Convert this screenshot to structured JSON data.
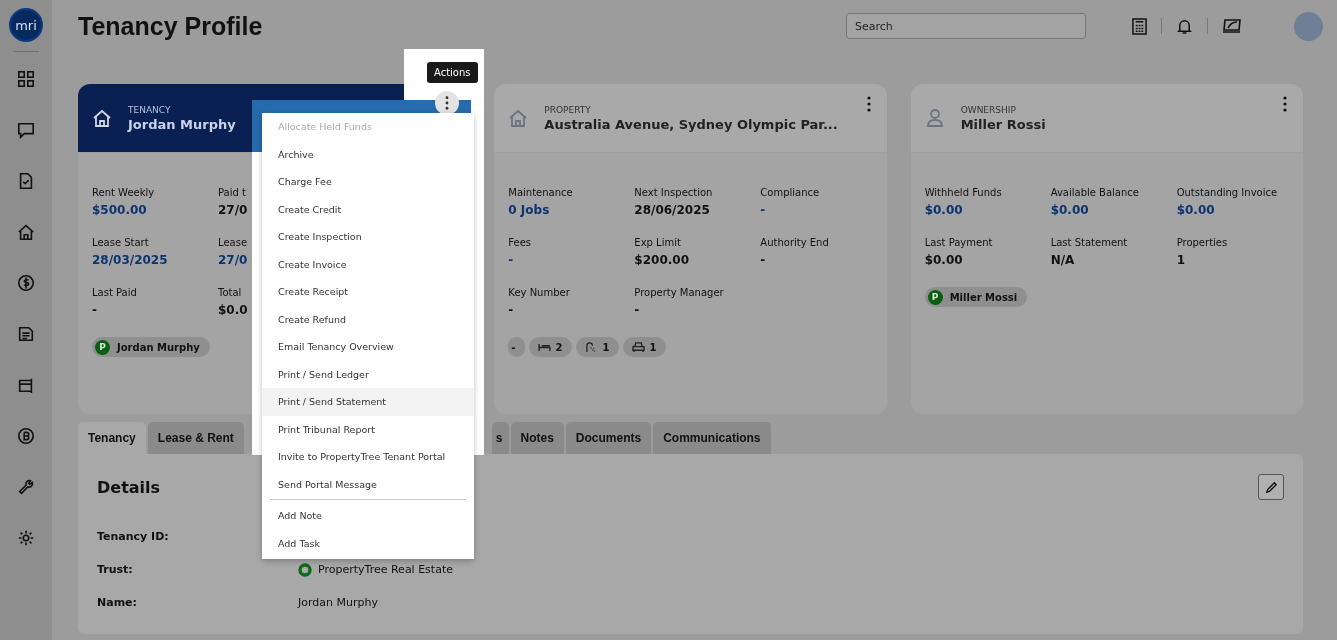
{
  "sidebar": {
    "logo": "mri"
  },
  "page": {
    "title": "Tenancy Profile"
  },
  "header": {
    "search": {
      "placeholder": "Search"
    }
  },
  "cards": [
    {
      "kind": "tenancy",
      "label": "TENANCY",
      "name": "Jordan Murphy",
      "rows": [
        [
          {
            "label": "Rent Weekly",
            "value": "$500.00",
            "link": true
          },
          {
            "label": "Paid t",
            "value": "27/0",
            "link": false
          }
        ],
        [
          {
            "label": "Lease Start",
            "value": "28/03/2025",
            "link": true
          },
          {
            "label": "Lease",
            "value": "27/0",
            "link": true
          }
        ],
        [
          {
            "label": "Last Paid",
            "value": "-",
            "link": false
          },
          {
            "label": "Total",
            "value": "$0.0",
            "link": false
          }
        ]
      ],
      "chips": [
        {
          "kind": "person",
          "badge": "P",
          "text": "Jordan Murphy"
        }
      ]
    },
    {
      "kind": "property",
      "label": "PROPERTY",
      "name": "Australia Avenue, Sydney Olympic Par...",
      "rows": [
        [
          {
            "label": "Maintenance",
            "value": "0 Jobs",
            "link": true
          },
          {
            "label": "Next Inspection",
            "value": "28/06/2025",
            "link": false
          },
          {
            "label": "Compliance",
            "value": "-",
            "link": true
          }
        ],
        [
          {
            "label": "Fees",
            "value": "-",
            "link": true
          },
          {
            "label": "Exp Limit",
            "value": "$200.00",
            "link": false
          },
          {
            "label": "Authority End",
            "value": "-",
            "link": false
          }
        ],
        [
          {
            "label": "Key Number",
            "value": "-",
            "link": false
          },
          {
            "label": "Property Manager",
            "value": "-",
            "link": false
          }
        ]
      ],
      "chips": [
        {
          "kind": "plain",
          "text": "-"
        },
        {
          "kind": "bed",
          "text": "2"
        },
        {
          "kind": "bath",
          "text": "1"
        },
        {
          "kind": "car",
          "text": "1"
        }
      ]
    },
    {
      "kind": "ownership",
      "label": "OWNERSHIP",
      "name": "Miller Rossi",
      "rows": [
        [
          {
            "label": "Withheld Funds",
            "value": "$0.00",
            "link": true
          },
          {
            "label": "Available Balance",
            "value": "$0.00",
            "link": true
          },
          {
            "label": "Outstanding Invoice",
            "value": "$0.00",
            "link": true
          }
        ],
        [
          {
            "label": "Last Payment",
            "value": "$0.00",
            "link": false
          },
          {
            "label": "Last Statement",
            "value": "N/A",
            "link": false
          },
          {
            "label": "Properties",
            "value": "1",
            "link": false
          }
        ]
      ],
      "chips": [
        {
          "kind": "person",
          "badge": "P",
          "text": "Miller Mossi"
        }
      ]
    }
  ],
  "tooltip": "Actions",
  "actions_menu": {
    "groups": [
      [
        {
          "label": "Allocate Held Funds",
          "disabled": true,
          "highlighted": false
        },
        {
          "label": "Archive",
          "disabled": false,
          "highlighted": false
        },
        {
          "label": "Charge Fee",
          "disabled": false,
          "highlighted": false
        },
        {
          "label": "Create Credit",
          "disabled": false,
          "highlighted": false
        },
        {
          "label": "Create Inspection",
          "disabled": false,
          "highlighted": false
        },
        {
          "label": "Create Invoice",
          "disabled": false,
          "highlighted": false
        },
        {
          "label": "Create Receipt",
          "disabled": false,
          "highlighted": false
        },
        {
          "label": "Create Refund",
          "disabled": false,
          "highlighted": false
        },
        {
          "label": "Email Tenancy Overview",
          "disabled": false,
          "highlighted": false
        },
        {
          "label": "Print / Send Ledger",
          "disabled": false,
          "highlighted": false
        },
        {
          "label": "Print / Send Statement",
          "disabled": false,
          "highlighted": true
        },
        {
          "label": "Print Tribunal Report",
          "disabled": false,
          "highlighted": false
        },
        {
          "label": "Invite to PropertyTree Tenant Portal",
          "disabled": false,
          "highlighted": false
        },
        {
          "label": "Send Portal Message",
          "disabled": false,
          "highlighted": false
        }
      ],
      [
        {
          "label": "Add Note",
          "disabled": false,
          "highlighted": false
        },
        {
          "label": "Add Task",
          "disabled": false,
          "highlighted": false
        }
      ]
    ]
  },
  "tabs": [
    {
      "label": "Tenancy",
      "selected": true,
      "clipped": false
    },
    {
      "label": "Lease & Rent",
      "selected": false,
      "clipped": false
    },
    {
      "label": "s",
      "selected": false,
      "clipped": true
    },
    {
      "label": "Notes",
      "selected": false,
      "clipped": false
    },
    {
      "label": "Documents",
      "selected": false,
      "clipped": false
    },
    {
      "label": "Communications",
      "selected": false,
      "clipped": false
    }
  ],
  "details": {
    "title": "Details",
    "rows": [
      {
        "kind": "text",
        "label": "Tenancy ID:"
      },
      {
        "kind": "trust",
        "label": "Trust:",
        "value": "PropertyTree Real Estate"
      },
      {
        "kind": "text",
        "label": "Name:",
        "value": "Jordan Murphy"
      }
    ]
  }
}
